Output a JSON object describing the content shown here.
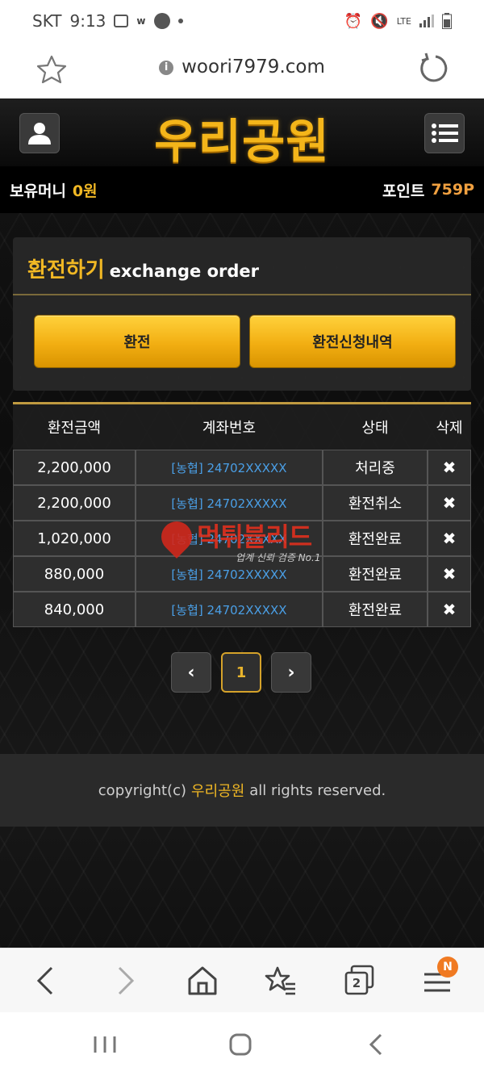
{
  "status_bar": {
    "carrier": "SKT",
    "time": "9:13",
    "network": "LTE"
  },
  "browser": {
    "url": "woori7979.com"
  },
  "site": {
    "logo_text": "우리공원",
    "money": {
      "label": "보유머니",
      "value": "0원"
    },
    "points": {
      "label": "포인트",
      "value": "759P"
    }
  },
  "exchange_panel": {
    "title_ko": "환전하기",
    "title_en": "exchange order",
    "exchange_button": "환전",
    "history_button": "환전신청내역"
  },
  "table": {
    "headers": [
      "환전금액",
      "계좌번호",
      "상태",
      "삭제"
    ],
    "rows": [
      {
        "amount": "2,200,000",
        "account": "[농협] 24702XXXXX",
        "status": "처리중"
      },
      {
        "amount": "2,200,000",
        "account": "[농협] 24702XXXXX",
        "status": "환전취소"
      },
      {
        "amount": "1,020,000",
        "account": "[농협] 24702XXXXX",
        "status": "환전완료"
      },
      {
        "amount": "880,000",
        "account": "[농협] 24702XXXXX",
        "status": "환전완료"
      },
      {
        "amount": "840,000",
        "account": "[농협] 24702XXXXX",
        "status": "환전완료"
      }
    ],
    "delete_symbol": "✖"
  },
  "pagination": {
    "prev": "‹",
    "current": "1",
    "next": "›"
  },
  "footer": {
    "prefix": "copyright(c)",
    "brand": "우리공원",
    "suffix": "all rights reserved."
  },
  "watermark": {
    "text": "먹튀블리드",
    "sub": "업계 신뢰 검증 No.1"
  },
  "toolbar": {
    "tabs_count": "2",
    "badge": "N"
  },
  "colors": {
    "gold": "#f1b824",
    "orange_points": "#f0a040",
    "link_blue": "#4a9fe6",
    "panel_bg": "#282828"
  }
}
